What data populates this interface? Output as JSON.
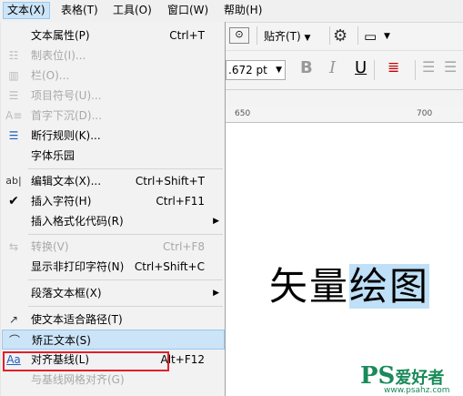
{
  "menubar": {
    "items": [
      {
        "label": "文本(X)"
      },
      {
        "label": "表格(T)"
      },
      {
        "label": "工具(O)"
      },
      {
        "label": "窗口(W)"
      },
      {
        "label": "帮助(H)"
      }
    ]
  },
  "toolbar": {
    "snap_label": "贴齐(T)",
    "font_size_value": ".672 pt"
  },
  "ruler": {
    "tick_label": "650",
    "tick_label_2": "700"
  },
  "canvas": {
    "text_plain": "矢量",
    "text_selected": "绘图"
  },
  "menu": {
    "items": [
      {
        "label": "文本属性(P)",
        "shortcut": "Ctrl+T",
        "icon": "text-properties-icon"
      },
      {
        "label": "制表位(I)...",
        "shortcut": "",
        "disabled": true,
        "icon": "tabs-icon"
      },
      {
        "label": "栏(O)...",
        "shortcut": "",
        "disabled": true,
        "icon": "columns-icon"
      },
      {
        "label": "项目符号(U)...",
        "shortcut": "",
        "disabled": true,
        "icon": "bullets-icon"
      },
      {
        "label": "首字下沉(D)...",
        "shortcut": "",
        "disabled": true,
        "icon": "drop-cap-icon"
      },
      {
        "label": "断行规则(K)...",
        "shortcut": "",
        "icon": "line-break-icon"
      },
      {
        "label": "字体乐园",
        "shortcut": ""
      },
      {
        "label": "编辑文本(X)...",
        "shortcut": "Ctrl+Shift+T",
        "icon": "edit-text-icon"
      },
      {
        "label": "插入字符(H)",
        "shortcut": "Ctrl+F11",
        "icon": "check-icon"
      },
      {
        "label": "插入格式化代码(R)",
        "shortcut": "",
        "submenu": true
      },
      {
        "label": "转换(V)",
        "shortcut": "Ctrl+F8",
        "disabled": true,
        "icon": "convert-icon"
      },
      {
        "label": "显示非打印字符(N)",
        "shortcut": "Ctrl+Shift+C"
      },
      {
        "label": "段落文本框(X)",
        "shortcut": "",
        "submenu": true
      },
      {
        "label": "使文本适合路径(T)",
        "shortcut": "",
        "icon": "fit-path-icon"
      },
      {
        "label": "矫正文本(S)",
        "shortcut": "",
        "icon": "straighten-text-icon",
        "highlighted": true
      },
      {
        "label": "对齐基线(L)",
        "shortcut": "Alt+F12",
        "icon": "align-baseline-icon"
      },
      {
        "label": "与基线网格对齐(G)",
        "shortcut": "",
        "disabled": true
      }
    ]
  },
  "watermark": {
    "brand": "PS",
    "name": "爱好者",
    "url": "www.psahz.com"
  }
}
